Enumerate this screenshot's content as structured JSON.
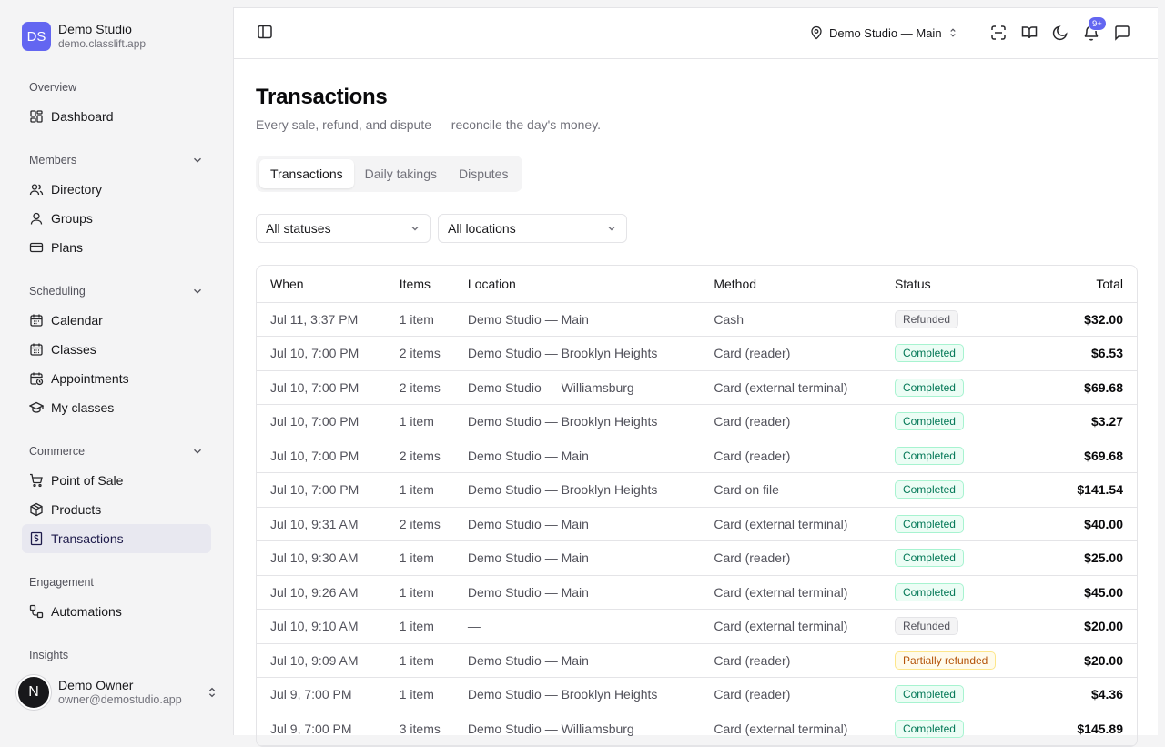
{
  "org": {
    "initials": "DS",
    "name": "Demo Studio",
    "domain": "demo.classlift.app",
    "logo_color": "#6366f1"
  },
  "nav": {
    "overview": {
      "title": "Overview",
      "items": {
        "dashboard": "Dashboard"
      }
    },
    "members": {
      "title": "Members",
      "items": {
        "directory": "Directory",
        "groups": "Groups",
        "plans": "Plans"
      }
    },
    "scheduling": {
      "title": "Scheduling",
      "items": {
        "calendar": "Calendar",
        "classes": "Classes",
        "appointments": "Appointments",
        "my_classes": "My classes"
      }
    },
    "commerce": {
      "title": "Commerce",
      "items": {
        "pos": "Point of Sale",
        "products": "Products",
        "transactions": "Transactions"
      }
    },
    "engagement": {
      "title": "Engagement",
      "items": {
        "automations": "Automations"
      }
    },
    "insights": {
      "title": "Insights"
    }
  },
  "user": {
    "initial": "N",
    "name": "Demo Owner",
    "email": "owner@demostudio.app"
  },
  "topbar": {
    "location": "Demo Studio — Main",
    "notification_badge": "9+"
  },
  "page": {
    "title": "Transactions",
    "subtitle": "Every sale, refund, and dispute — reconcile the day's money."
  },
  "tabs": {
    "transactions": "Transactions",
    "daily": "Daily takings",
    "disputes": "Disputes"
  },
  "filters": {
    "status": "All statuses",
    "location": "All locations"
  },
  "table": {
    "headers": {
      "when": "When",
      "items": "Items",
      "location": "Location",
      "method": "Method",
      "status": "Status",
      "total": "Total"
    },
    "rows": [
      {
        "when": "Jul 11, 3:37 PM",
        "items": "1 item",
        "location": "Demo Studio — Main",
        "method": "Cash",
        "status": "Refunded",
        "kind": "refunded",
        "total": "$32.00"
      },
      {
        "when": "Jul 10, 7:00 PM",
        "items": "2 items",
        "location": "Demo Studio — Brooklyn Heights",
        "method": "Card (reader)",
        "status": "Completed",
        "kind": "completed",
        "total": "$6.53"
      },
      {
        "when": "Jul 10, 7:00 PM",
        "items": "2 items",
        "location": "Demo Studio — Williamsburg",
        "method": "Card (external terminal)",
        "status": "Completed",
        "kind": "completed",
        "total": "$69.68"
      },
      {
        "when": "Jul 10, 7:00 PM",
        "items": "1 item",
        "location": "Demo Studio — Brooklyn Heights",
        "method": "Card (reader)",
        "status": "Completed",
        "kind": "completed",
        "total": "$3.27"
      },
      {
        "when": "Jul 10, 7:00 PM",
        "items": "2 items",
        "location": "Demo Studio — Main",
        "method": "Card (reader)",
        "status": "Completed",
        "kind": "completed",
        "total": "$69.68"
      },
      {
        "when": "Jul 10, 7:00 PM",
        "items": "1 item",
        "location": "Demo Studio — Brooklyn Heights",
        "method": "Card on file",
        "status": "Completed",
        "kind": "completed",
        "total": "$141.54"
      },
      {
        "when": "Jul 10, 9:31 AM",
        "items": "2 items",
        "location": "Demo Studio — Main",
        "method": "Card (external terminal)",
        "status": "Completed",
        "kind": "completed",
        "total": "$40.00"
      },
      {
        "when": "Jul 10, 9:30 AM",
        "items": "1 item",
        "location": "Demo Studio — Main",
        "method": "Card (reader)",
        "status": "Completed",
        "kind": "completed",
        "total": "$25.00"
      },
      {
        "when": "Jul 10, 9:26 AM",
        "items": "1 item",
        "location": "Demo Studio — Main",
        "method": "Card (external terminal)",
        "status": "Completed",
        "kind": "completed",
        "total": "$45.00"
      },
      {
        "when": "Jul 10, 9:10 AM",
        "items": "1 item",
        "location": "—",
        "method": "Card (external terminal)",
        "status": "Refunded",
        "kind": "refunded",
        "total": "$20.00"
      },
      {
        "when": "Jul 10, 9:09 AM",
        "items": "1 item",
        "location": "Demo Studio — Main",
        "method": "Card (reader)",
        "status": "Partially refunded",
        "kind": "partial",
        "total": "$20.00"
      },
      {
        "when": "Jul 9, 7:00 PM",
        "items": "1 item",
        "location": "Demo Studio — Brooklyn Heights",
        "method": "Card (reader)",
        "status": "Completed",
        "kind": "completed",
        "total": "$4.36"
      },
      {
        "when": "Jul 9, 7:00 PM",
        "items": "3 items",
        "location": "Demo Studio — Williamsburg",
        "method": "Card (external terminal)",
        "status": "Completed",
        "kind": "completed",
        "total": "$145.89"
      }
    ]
  }
}
